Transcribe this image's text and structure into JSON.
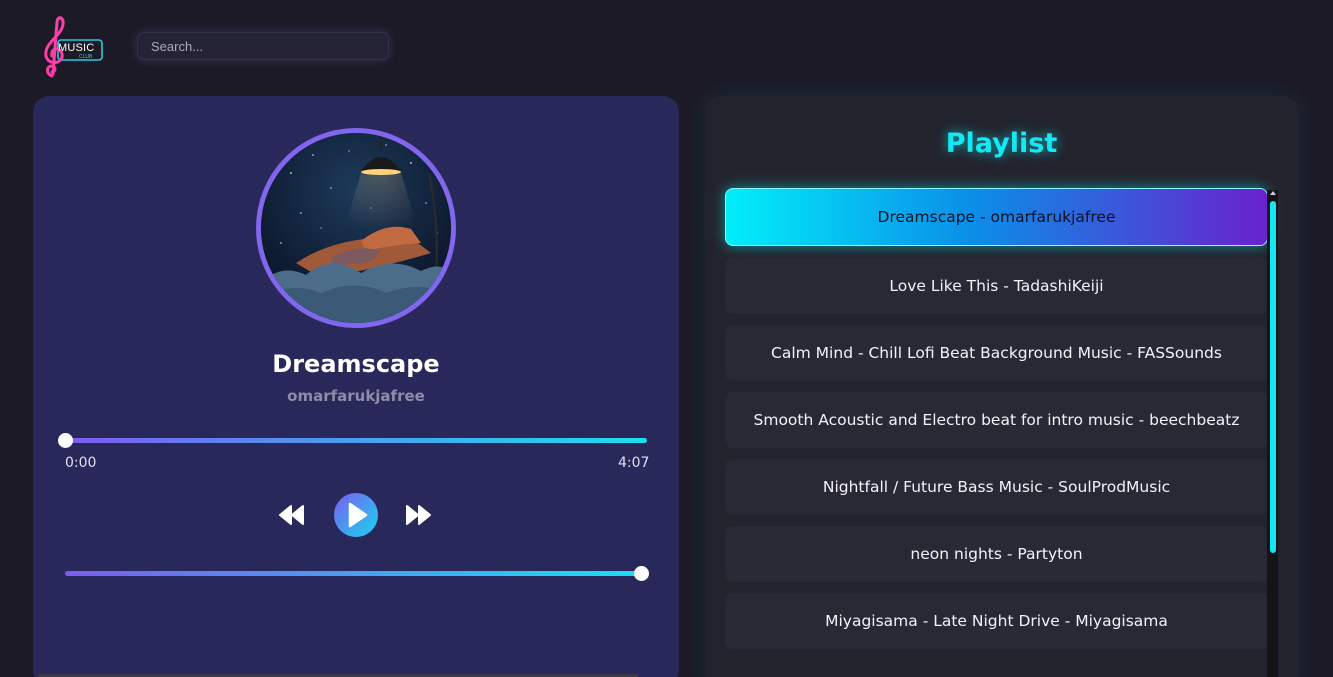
{
  "header": {
    "logo_text": "MUSIC",
    "logo_sub": "CLUB",
    "search_placeholder": "Search..."
  },
  "player": {
    "title": "Dreamscape",
    "artist": "omarfarukjafree",
    "current_time": "0:00",
    "duration": "4:07",
    "progress": 0.0,
    "volume": 1.0
  },
  "playlist": {
    "title": "Playlist",
    "items": [
      {
        "label": "Dreamscape - omarfarukjafree",
        "active": true
      },
      {
        "label": "Love Like This - TadashiKeiji",
        "active": false
      },
      {
        "label": "Calm Mind - Chill Lofi Beat Background Music - FASSounds",
        "active": false
      },
      {
        "label": "Smooth Acoustic and Electro beat for intro music - beechbeatz",
        "active": false
      },
      {
        "label": "Nightfall / Future Bass Music - SoulProdMusic",
        "active": false
      },
      {
        "label": "neon nights - Partyton",
        "active": false
      },
      {
        "label": "Miyagisama - Late Night Drive - Miyagisama",
        "active": false
      }
    ]
  },
  "colors": {
    "accent_cyan": "#12e9f5",
    "accent_purple": "#7b5cf0",
    "player_bg": "#29285a",
    "playlist_bg": "#23232d"
  }
}
